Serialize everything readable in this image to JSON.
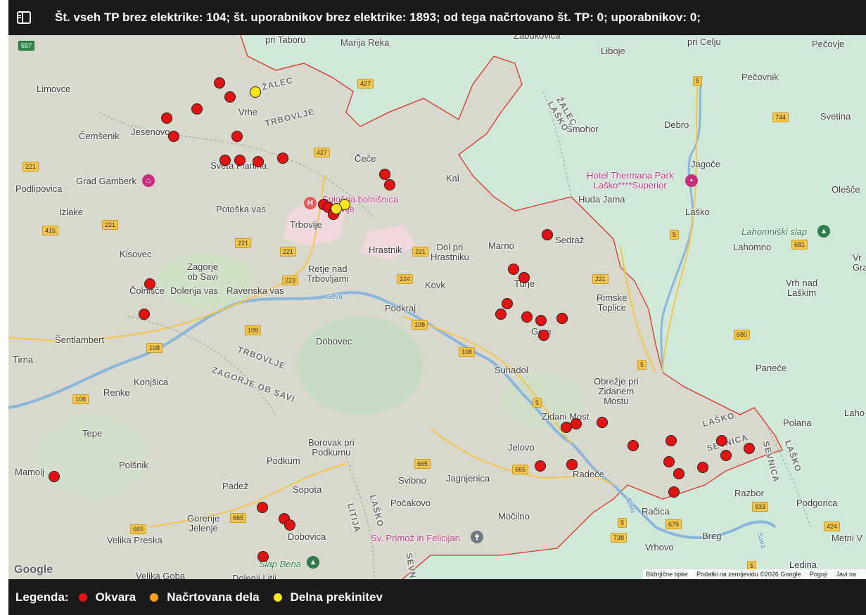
{
  "header": {
    "title": "Št. vseh TP brez elektrike: 104; št. uporabnikov brez elektrike: 1893; od tega načrtovano št. TP: 0; uporabnikov: 0;",
    "toggle_icon": "sidebar-toggle-icon"
  },
  "map": {
    "places": {
      "pri_taboru": "pri Taboru",
      "marija_reka": "Marija Reka",
      "zabukovica": "Zabukovica",
      "liboje": "Liboje",
      "pri_celju": "pri Celju",
      "pecovje": "Pečovje",
      "limovce": "Limovce",
      "vrhe": "Vrhe",
      "pecovnik": "Pečovnik",
      "cemsenik": "Čemšenik",
      "jesenovo": "Jesenovo",
      "smohor": "Šmohor",
      "debro": "Debro",
      "svetina": "Svetina",
      "sveta_planina": "Sveta Planina",
      "cece": "Čeče",
      "jagoce": "Jagoče",
      "grad_gamberk": "Grad Gamberk",
      "kal": "Kal",
      "hotel_thermana": "Hotel Thermana Park\nLaško****Superior",
      "olesce": "Olešče",
      "podlipovica": "Podlipovica",
      "izlake": "Izlake",
      "potoska_vas": "Potoška vas",
      "splosna_bolnisnica": "Splošna bolnišnica\nTrbovlje",
      "huda_jama": "Huda Jama",
      "lasko": "Laško",
      "trbovlje": "Trbovlje",
      "lahomniski_slap": "Lahomniški slap",
      "sedraz": "Sedraž",
      "lahomno": "Lahomno",
      "kisovec": "Kisovec",
      "zagorje_ob_savi": "Zagorje\nob Savi",
      "hrastnik": "Hrastnik",
      "dol_pri_hrastniku": "Dol pri\nHrastniku",
      "marno": "Marno",
      "retje_nad_trbovljami": "Retje nad\nTrbovljami",
      "vrh_edge": "Vr\nGra",
      "colnisce": "Čolnišče",
      "dolenja_vas": "Dolenja vas",
      "ravenska_vas": "Ravenska vas",
      "kovk": "Kovk",
      "turje": "Turje",
      "vrh_nad_laskim": "Vrh nad\nLaškim",
      "rimske_toplice": "Rimske\nToplice",
      "podkraj": "Podkraj",
      "gore": "Gore",
      "sentlambert": "Šentlambert",
      "dobovec": "Dobovec",
      "tirna": "Tirna",
      "suhadol": "Suhadol",
      "panece": "Paneče",
      "konjsica": "Konjšica",
      "obrezje": "Obrežje pri\nZidanem\nMostu",
      "renke": "Renke",
      "laho_edge": "Laho",
      "zidani_most": "Zidani Most",
      "polana": "Polana",
      "tepe": "Tepe",
      "borovak": "Borovak pri\nPodkumu",
      "jelovo": "Jelovo",
      "polsnik": "Polšnik",
      "podkum": "Podkum",
      "mamolj": "Mamolj",
      "svibno": "Svibno",
      "jagnjenica": "Jagnjenica",
      "radece": "Radeče",
      "razbor": "Razbor",
      "padez": "Padež",
      "sopota": "Sopota",
      "pocakovo": "Počakovo",
      "podgorica": "Podgorica",
      "gorenje_jelenje": "Gorenje\nJelenje",
      "mocilno": "Močilno",
      "racica": "Račica",
      "velika_preska": "Velika Preska",
      "dobovica": "Dobovica",
      "sv_primoz": "Sv. Primož in Felicijan",
      "breg": "Breg",
      "metni_vrh": "Metni V",
      "vrhovo": "Vrhovo",
      "slap_bena": "Slap Bena",
      "ledina": "Ledina",
      "velika_goba": "Velika Goba",
      "dolenji_litija": "Dolenji Litij"
    },
    "admin": {
      "zalec_top": "ŽALEC",
      "trbovlje_top": "TRBOVLJE",
      "zalec_lasko": "ŽALEC\nLAŠKO",
      "trbovlje_mid": "TRBOVLJE",
      "zagorje": "ZAGORJE OB SAVI",
      "lasko_se": "LAŠKO",
      "sevnica": "SEVNICA",
      "sevnica2": "SEVNICA",
      "lasko_vert": "LAŠKO",
      "lasko_litija": "LAŠKO",
      "litija": "LITIJA",
      "sevn_bottom": "SEVN"
    },
    "water": {
      "sava1": "Sava",
      "sava2": "Sava",
      "sava3": "Sava"
    },
    "roads": [
      "557",
      "427",
      "5",
      "744",
      "427",
      "221",
      "221",
      "415",
      "221",
      "221",
      "223",
      "5",
      "681",
      "221",
      "224",
      "221",
      "108",
      "108",
      "108",
      "108",
      "108",
      "680",
      "5",
      "665",
      "665",
      "665",
      "933",
      "424",
      "5",
      "679",
      "738",
      "5"
    ],
    "google_logo": "Google",
    "footnote": {
      "shortcuts": "Bližnjične tipke",
      "data": "Podatki na zemljevidu ©2026 Google",
      "terms": "Pogoji",
      "report": "Javi na"
    },
    "colors": {
      "okvara": "#e41313",
      "delna": "#f7e51a",
      "nacrtovana": "#f5a020",
      "boundary": "#d9342b"
    }
  },
  "legend": {
    "title": "Legenda:",
    "items": [
      {
        "label": "Okvara",
        "color": "#e41313"
      },
      {
        "label": "Načrtovana dela",
        "color": "#f5a020"
      },
      {
        "label": "Delna prekinitev",
        "color": "#f7e51a"
      }
    ]
  }
}
